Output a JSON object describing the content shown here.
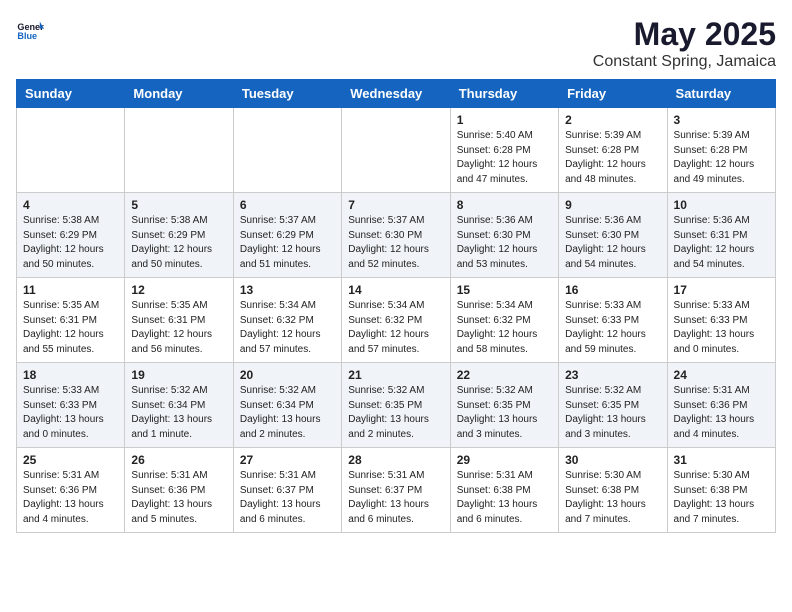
{
  "header": {
    "logo_general": "General",
    "logo_blue": "Blue",
    "month": "May 2025",
    "location": "Constant Spring, Jamaica"
  },
  "weekdays": [
    "Sunday",
    "Monday",
    "Tuesday",
    "Wednesday",
    "Thursday",
    "Friday",
    "Saturday"
  ],
  "weeks": [
    [
      {
        "day": "",
        "info": ""
      },
      {
        "day": "",
        "info": ""
      },
      {
        "day": "",
        "info": ""
      },
      {
        "day": "",
        "info": ""
      },
      {
        "day": "1",
        "info": "Sunrise: 5:40 AM\nSunset: 6:28 PM\nDaylight: 12 hours\nand 47 minutes."
      },
      {
        "day": "2",
        "info": "Sunrise: 5:39 AM\nSunset: 6:28 PM\nDaylight: 12 hours\nand 48 minutes."
      },
      {
        "day": "3",
        "info": "Sunrise: 5:39 AM\nSunset: 6:28 PM\nDaylight: 12 hours\nand 49 minutes."
      }
    ],
    [
      {
        "day": "4",
        "info": "Sunrise: 5:38 AM\nSunset: 6:29 PM\nDaylight: 12 hours\nand 50 minutes."
      },
      {
        "day": "5",
        "info": "Sunrise: 5:38 AM\nSunset: 6:29 PM\nDaylight: 12 hours\nand 50 minutes."
      },
      {
        "day": "6",
        "info": "Sunrise: 5:37 AM\nSunset: 6:29 PM\nDaylight: 12 hours\nand 51 minutes."
      },
      {
        "day": "7",
        "info": "Sunrise: 5:37 AM\nSunset: 6:30 PM\nDaylight: 12 hours\nand 52 minutes."
      },
      {
        "day": "8",
        "info": "Sunrise: 5:36 AM\nSunset: 6:30 PM\nDaylight: 12 hours\nand 53 minutes."
      },
      {
        "day": "9",
        "info": "Sunrise: 5:36 AM\nSunset: 6:30 PM\nDaylight: 12 hours\nand 54 minutes."
      },
      {
        "day": "10",
        "info": "Sunrise: 5:36 AM\nSunset: 6:31 PM\nDaylight: 12 hours\nand 54 minutes."
      }
    ],
    [
      {
        "day": "11",
        "info": "Sunrise: 5:35 AM\nSunset: 6:31 PM\nDaylight: 12 hours\nand 55 minutes."
      },
      {
        "day": "12",
        "info": "Sunrise: 5:35 AM\nSunset: 6:31 PM\nDaylight: 12 hours\nand 56 minutes."
      },
      {
        "day": "13",
        "info": "Sunrise: 5:34 AM\nSunset: 6:32 PM\nDaylight: 12 hours\nand 57 minutes."
      },
      {
        "day": "14",
        "info": "Sunrise: 5:34 AM\nSunset: 6:32 PM\nDaylight: 12 hours\nand 57 minutes."
      },
      {
        "day": "15",
        "info": "Sunrise: 5:34 AM\nSunset: 6:32 PM\nDaylight: 12 hours\nand 58 minutes."
      },
      {
        "day": "16",
        "info": "Sunrise: 5:33 AM\nSunset: 6:33 PM\nDaylight: 12 hours\nand 59 minutes."
      },
      {
        "day": "17",
        "info": "Sunrise: 5:33 AM\nSunset: 6:33 PM\nDaylight: 13 hours\nand 0 minutes."
      }
    ],
    [
      {
        "day": "18",
        "info": "Sunrise: 5:33 AM\nSunset: 6:33 PM\nDaylight: 13 hours\nand 0 minutes."
      },
      {
        "day": "19",
        "info": "Sunrise: 5:32 AM\nSunset: 6:34 PM\nDaylight: 13 hours\nand 1 minute."
      },
      {
        "day": "20",
        "info": "Sunrise: 5:32 AM\nSunset: 6:34 PM\nDaylight: 13 hours\nand 2 minutes."
      },
      {
        "day": "21",
        "info": "Sunrise: 5:32 AM\nSunset: 6:35 PM\nDaylight: 13 hours\nand 2 minutes."
      },
      {
        "day": "22",
        "info": "Sunrise: 5:32 AM\nSunset: 6:35 PM\nDaylight: 13 hours\nand 3 minutes."
      },
      {
        "day": "23",
        "info": "Sunrise: 5:32 AM\nSunset: 6:35 PM\nDaylight: 13 hours\nand 3 minutes."
      },
      {
        "day": "24",
        "info": "Sunrise: 5:31 AM\nSunset: 6:36 PM\nDaylight: 13 hours\nand 4 minutes."
      }
    ],
    [
      {
        "day": "25",
        "info": "Sunrise: 5:31 AM\nSunset: 6:36 PM\nDaylight: 13 hours\nand 4 minutes."
      },
      {
        "day": "26",
        "info": "Sunrise: 5:31 AM\nSunset: 6:36 PM\nDaylight: 13 hours\nand 5 minutes."
      },
      {
        "day": "27",
        "info": "Sunrise: 5:31 AM\nSunset: 6:37 PM\nDaylight: 13 hours\nand 6 minutes."
      },
      {
        "day": "28",
        "info": "Sunrise: 5:31 AM\nSunset: 6:37 PM\nDaylight: 13 hours\nand 6 minutes."
      },
      {
        "day": "29",
        "info": "Sunrise: 5:31 AM\nSunset: 6:38 PM\nDaylight: 13 hours\nand 6 minutes."
      },
      {
        "day": "30",
        "info": "Sunrise: 5:30 AM\nSunset: 6:38 PM\nDaylight: 13 hours\nand 7 minutes."
      },
      {
        "day": "31",
        "info": "Sunrise: 5:30 AM\nSunset: 6:38 PM\nDaylight: 13 hours\nand 7 minutes."
      }
    ]
  ]
}
